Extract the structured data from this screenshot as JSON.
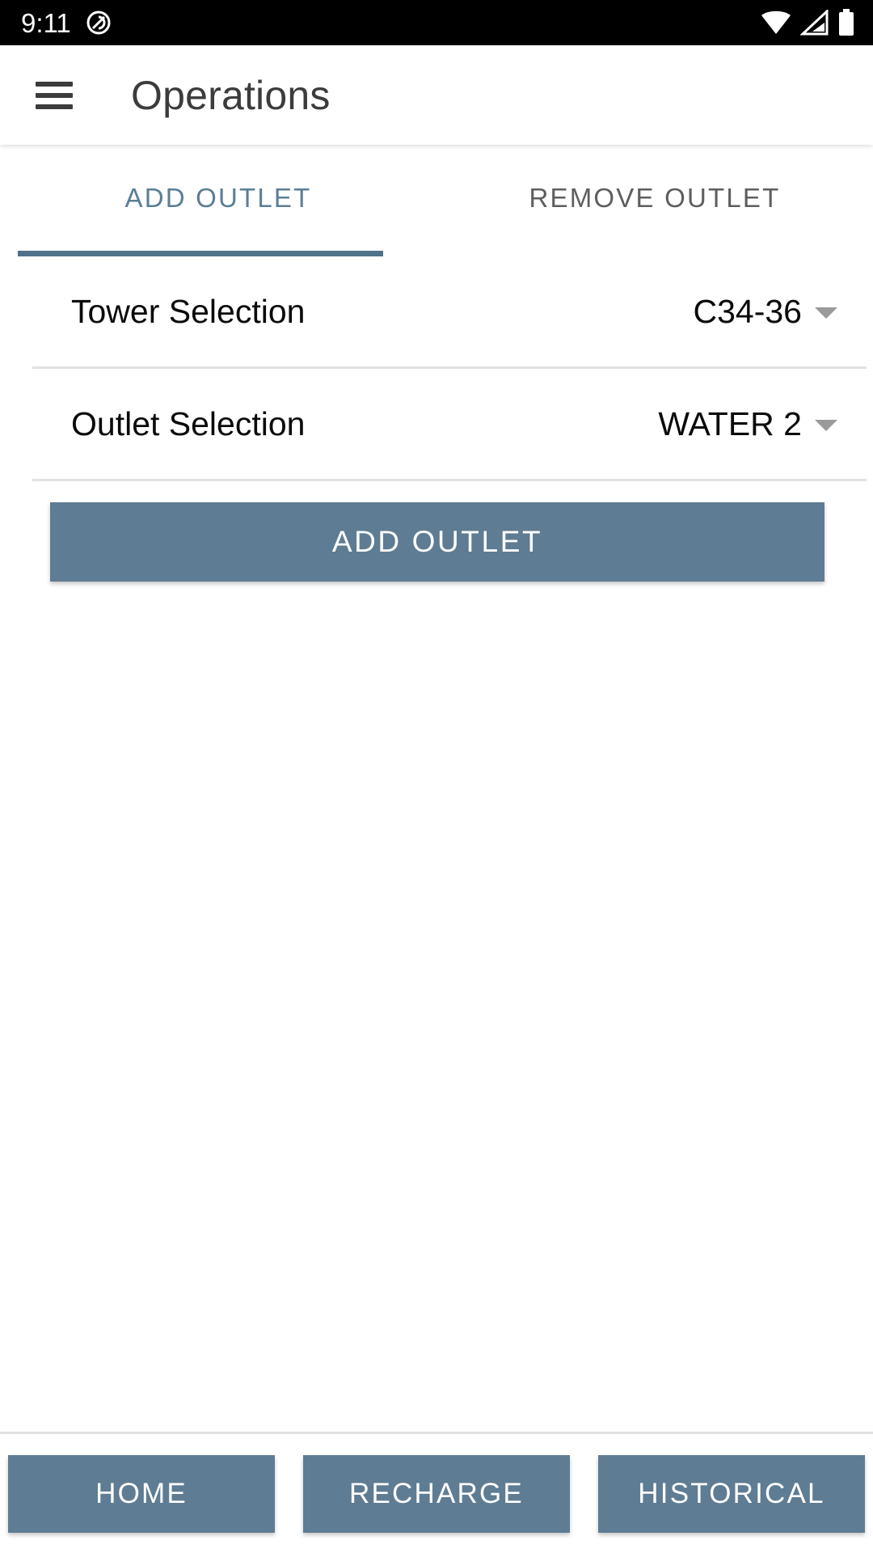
{
  "status_bar": {
    "time": "9:11",
    "notification_icon": "circle-slash-icon",
    "wifi_icon": "wifi-icon",
    "signal_icon": "signal-triangle-icon",
    "battery_icon": "battery-full-icon",
    "background_color": "#000000"
  },
  "app_bar": {
    "menu_icon": "hamburger-menu-icon",
    "title": "Operations",
    "title_color": "#3c3c3c"
  },
  "tabs": {
    "active_index": 0,
    "active_color": "#5b7e96",
    "inactive_color": "#5e5e5e",
    "indicator_color": "#4f7189",
    "items": [
      {
        "label": "ADD OUTLET",
        "active": true
      },
      {
        "label": "REMOVE OUTLET",
        "active": false
      }
    ]
  },
  "form": {
    "rows": [
      {
        "label": "Tower Selection",
        "value": "C34-36",
        "caret_icon": "chevron-down-icon"
      },
      {
        "label": "Outlet Selection",
        "value": "WATER 2",
        "caret_icon": "chevron-down-icon"
      }
    ],
    "primary_button": {
      "label": "ADD OUTLET",
      "background_color": "#5e7c93",
      "text_color": "#ffffff"
    }
  },
  "bottom_nav": {
    "button_color": "#5e7c93",
    "buttons": [
      {
        "label": "HOME"
      },
      {
        "label": "RECHARGE"
      },
      {
        "label": "HISTORICAL"
      }
    ]
  },
  "colors": {
    "accent": "#5e7c93",
    "divider": "#e2e2e2",
    "page_background": "#ffffff",
    "text_primary": "#0a0a0a"
  }
}
